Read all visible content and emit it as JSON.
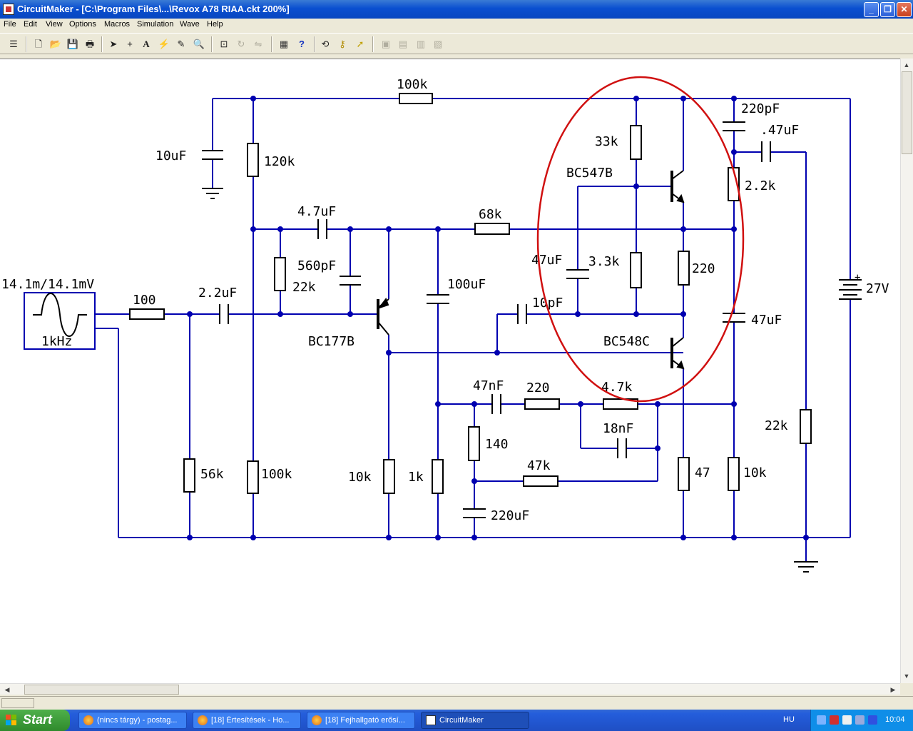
{
  "window": {
    "title": "CircuitMaker - [C:\\Program Files\\...\\Revox A78 RIAA.ckt 200%]",
    "controls": [
      "minimize",
      "restore",
      "close"
    ]
  },
  "menu": [
    "File",
    "Edit",
    "View",
    "Options",
    "Macros",
    "Simulation",
    "Wave",
    "Help"
  ],
  "toolbar": [
    {
      "icon": "stack-icon"
    },
    {
      "icon": "new-file-icon"
    },
    {
      "icon": "open-folder-icon"
    },
    {
      "icon": "save-icon"
    },
    {
      "icon": "print-icon"
    },
    {
      "icon": "arrow-select-icon"
    },
    {
      "icon": "wire-cross-icon"
    },
    {
      "icon": "text-icon"
    },
    {
      "icon": "probe-icon"
    },
    {
      "icon": "pen-icon"
    },
    {
      "icon": "zoom-icon"
    },
    {
      "icon": "zoom-fit-icon"
    },
    {
      "icon": "rotate-icon"
    },
    {
      "icon": "mirror-icon"
    },
    {
      "icon": "netlist-icon"
    },
    {
      "icon": "help-icon"
    },
    {
      "icon": "reset-icon"
    },
    {
      "icon": "key-icon"
    },
    {
      "icon": "run-icon"
    },
    {
      "icon": "component-icon"
    },
    {
      "icon": "grid-icon"
    },
    {
      "icon": "graph-icon"
    },
    {
      "icon": "wave-icon"
    }
  ],
  "schematic": {
    "labels": {
      "source_value": "14.1m/14.1mV",
      "source_freq": "1kHz",
      "r_100_top": "100k",
      "c_10uF": "10uF",
      "r_120k": "120k",
      "c_4_7uF": "4.7uF",
      "r_68k": "68k",
      "c_560pF": "560pF",
      "r_22k_left": "22k",
      "c_100uF": "100uF",
      "r_100": "100",
      "c_2_2uF": "2.2uF",
      "q_BC177B": "BC177B",
      "r_33k": "33k",
      "q_BC547B": "BC547B",
      "c_47uF_mid": "47uF",
      "r_3_3k": "3.3k",
      "r_220_mid": "220",
      "c_10pF": "10pF",
      "q_BC548C": "BC548C",
      "c_220pF": "220pF",
      "c_47uF_out": ".47uF",
      "r_2_2k": "2.2k",
      "c_47uF_right": "47uF",
      "battery": "27V",
      "battery_plus": "+",
      "c_47nF": "47nF",
      "r_220_low": "220",
      "r_4_7k": "4.7k",
      "c_18nF": "18nF",
      "r_140": "140",
      "r_47k": "47k",
      "c_220uF": "220uF",
      "r_56k": "56k",
      "r_100k_low": "100k",
      "r_10k_left": "10k",
      "r_1k": "1k",
      "r_47": "47",
      "r_10k_right": "10k",
      "r_22k_right": "22k"
    },
    "colors": {
      "wire": "#0000b0",
      "highlight": "#d01010"
    }
  },
  "taskbar": {
    "start": "Start",
    "tasks": [
      {
        "label": "(nincs tárgy) - postag...",
        "active": false
      },
      {
        "label": "[18] Értesítések - Ho...",
        "active": false
      },
      {
        "label": "[18] Fejhallgató erősí...",
        "active": false
      },
      {
        "label": "CircuitMaker",
        "active": true
      }
    ],
    "language": "HU",
    "clock": "10:04"
  }
}
